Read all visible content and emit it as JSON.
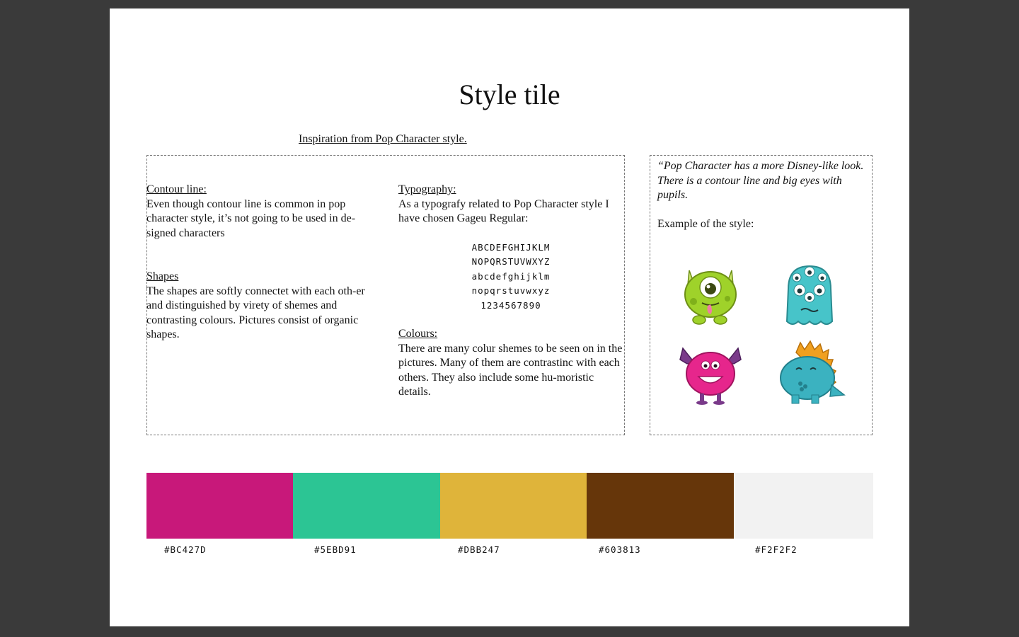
{
  "title": "Style tile",
  "inspiration": "Inspiration from Pop Character style.",
  "left": {
    "contour_heading": "Contour line:",
    "contour_text": "Even though contour line is common in pop character style, it’s not going to be used in de-signed characters",
    "shapes_heading": "Shapes",
    "shapes_text": "The shapes are softly connectet with each oth-er and distinguished by virety of shemes and contrasting colours. Pictures consist of organic shapes."
  },
  "right": {
    "typography_heading": "Typography:",
    "typography_text": "As a typografy related to Pop Character style I have chosen Gageu Regular:",
    "sample": [
      "ABCDEFGHIJKLM",
      "NOPQRSTUVWXYZ",
      "abcdefghijklm",
      "nopqrstuvwxyz",
      "1234567890"
    ],
    "colours_heading": "Colours:",
    "colours_text": "There are many colur shemes to be seen on in the pictures. Many of them are contrastinc with each others. They also include some hu-moristic details."
  },
  "side": {
    "quote": "“Pop Character has a more Disney-like look. There is a contour line and big eyes with pupils.",
    "example": "Example of the style:"
  },
  "palette": [
    {
      "hex": "#BC427D",
      "color": "#c8187a"
    },
    {
      "hex": "#5EBD91",
      "color": "#2cc594"
    },
    {
      "hex": "#DBB247",
      "color": "#dfb43a"
    },
    {
      "hex": "#603813",
      "color": "#66360a"
    },
    {
      "hex": "#F2F2F2",
      "color": "#f2f2f2"
    }
  ]
}
